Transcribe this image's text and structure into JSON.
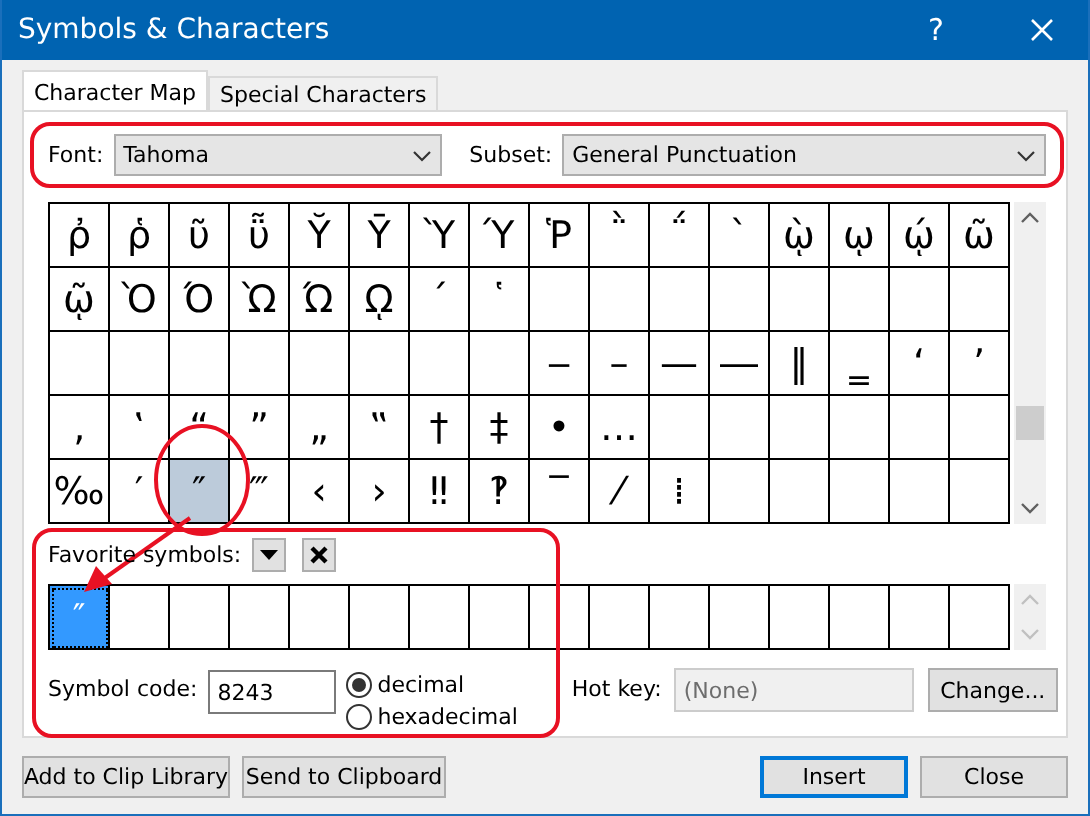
{
  "window": {
    "title": "Symbols & Characters",
    "help": "?"
  },
  "tabs": [
    {
      "label": "Character Map",
      "selected": true
    },
    {
      "label": "Special Characters",
      "selected": false
    }
  ],
  "font": {
    "label": "Font:",
    "value": "Tahoma"
  },
  "subset": {
    "label": "Subset:",
    "value": "General Punctuation"
  },
  "character_grid": {
    "rows": [
      [
        {
          "symbol": "ῤ",
          "selected": false
        },
        {
          "symbol": "ῥ",
          "selected": false
        },
        {
          "symbol": "ῦ",
          "selected": false
        },
        {
          "symbol": "ῧ",
          "selected": false
        },
        {
          "symbol": "Ῠ",
          "selected": false
        },
        {
          "symbol": "Ῡ",
          "selected": false
        },
        {
          "symbol": "Ὺ",
          "selected": false
        },
        {
          "symbol": "Ύ",
          "selected": false
        },
        {
          "symbol": "Ῥ",
          "selected": false
        },
        {
          "symbol": "῭",
          "selected": false
        },
        {
          "symbol": "΅",
          "selected": false
        },
        {
          "symbol": "`",
          "selected": false
        },
        {
          "symbol": "ῲ",
          "selected": false
        },
        {
          "symbol": "ῳ",
          "selected": false
        },
        {
          "symbol": "ῴ",
          "selected": false
        },
        {
          "symbol": "ῶ",
          "selected": false
        }
      ],
      [
        {
          "symbol": "ῷ",
          "selected": false
        },
        {
          "symbol": "Ὸ",
          "selected": false
        },
        {
          "symbol": "Ό",
          "selected": false
        },
        {
          "symbol": "Ὼ",
          "selected": false
        },
        {
          "symbol": "Ώ",
          "selected": false
        },
        {
          "symbol": "ῼ",
          "selected": false
        },
        {
          "symbol": "´",
          "selected": false
        },
        {
          "symbol": "῾",
          "selected": false
        },
        {
          "selected": false
        },
        {
          "selected": false
        },
        {
          "selected": false
        },
        {
          "selected": false
        },
        {
          "selected": false
        },
        {
          "selected": false
        },
        {
          "selected": false
        },
        {
          "selected": false
        }
      ],
      [
        {
          "selected": false
        },
        {
          "selected": false
        },
        {
          "selected": false
        },
        {
          "selected": false
        },
        {
          "selected": false
        },
        {
          "selected": false
        },
        {
          "selected": false
        },
        {
          "selected": false
        },
        {
          "symbol": "‒",
          "selected": false
        },
        {
          "symbol": "–",
          "selected": false
        },
        {
          "symbol": "—",
          "selected": false
        },
        {
          "symbol": "―",
          "selected": false
        },
        {
          "symbol": "‖",
          "selected": false
        },
        {
          "symbol": "‗",
          "selected": false
        },
        {
          "symbol": "‘",
          "selected": false
        },
        {
          "symbol": "’",
          "selected": false
        }
      ],
      [
        {
          "symbol": "‚",
          "selected": false
        },
        {
          "symbol": "‛",
          "selected": false
        },
        {
          "symbol": "“",
          "selected": false
        },
        {
          "symbol": "”",
          "selected": false
        },
        {
          "symbol": "„",
          "selected": false
        },
        {
          "symbol": "‟",
          "selected": false
        },
        {
          "symbol": "†",
          "selected": false
        },
        {
          "symbol": "‡",
          "selected": false
        },
        {
          "symbol": "•",
          "selected": false
        },
        {
          "symbol": "…",
          "selected": false
        },
        {
          "selected": false
        },
        {
          "selected": false
        },
        {
          "selected": false
        },
        {
          "selected": false
        },
        {
          "selected": false
        },
        {
          "selected": false
        }
      ],
      [
        {
          "symbol": "‰",
          "selected": false
        },
        {
          "symbol": "′",
          "selected": false
        },
        {
          "symbol": "″",
          "selected": true
        },
        {
          "symbol": "‴",
          "selected": false
        },
        {
          "symbol": "‹",
          "selected": false
        },
        {
          "symbol": "›",
          "selected": false
        },
        {
          "symbol": "‼",
          "selected": false
        },
        {
          "symbol": "‽",
          "selected": false
        },
        {
          "symbol": "‾",
          "selected": false
        },
        {
          "symbol": "⁄",
          "selected": false
        },
        {
          "symbol": "⁞",
          "selected": false
        },
        {
          "selected": false
        },
        {
          "selected": false
        },
        {
          "selected": false
        },
        {
          "selected": false
        },
        {
          "selected": false
        }
      ]
    ]
  },
  "favorites": {
    "label": "Favorite symbols:",
    "cells": [
      {
        "symbol": "″",
        "selected": true
      },
      {
        "selected": false
      },
      {
        "selected": false
      },
      {
        "selected": false
      },
      {
        "selected": false
      },
      {
        "selected": false
      },
      {
        "selected": false
      },
      {
        "selected": false
      },
      {
        "selected": false
      },
      {
        "selected": false
      },
      {
        "selected": false
      },
      {
        "selected": false
      },
      {
        "selected": false
      },
      {
        "selected": false
      },
      {
        "selected": false
      },
      {
        "selected": false
      }
    ]
  },
  "symbol_code": {
    "label": "Symbol code:",
    "value": "8243"
  },
  "code_format": [
    {
      "label": "decimal",
      "selected": true
    },
    {
      "label": "hexadecimal",
      "selected": false
    }
  ],
  "hot_key": {
    "label": "Hot key:",
    "value": "(None)",
    "disabled": true
  },
  "change_button": "Change...",
  "buttons": [
    {
      "label": "Add to Clip Library",
      "default": false
    },
    {
      "label": "Send to Clipboard",
      "default": false
    },
    {
      "label": "Insert",
      "default": true
    },
    {
      "label": "Close",
      "default": false
    }
  ],
  "annotations": [
    {
      "kind": "frame"
    },
    {
      "kind": "ellipse"
    },
    {
      "kind": "frame"
    },
    {
      "kind": "arrow"
    }
  ]
}
